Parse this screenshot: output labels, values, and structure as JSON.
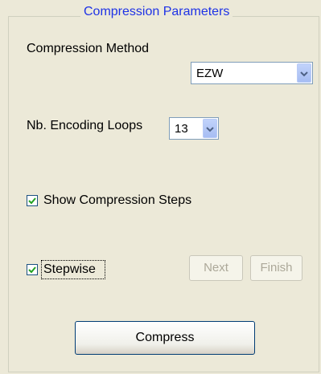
{
  "group": {
    "title": "Compression Parameters"
  },
  "compression_method": {
    "label": "Compression Method",
    "value": "EZW"
  },
  "encoding_loops": {
    "label": "Nb. Encoding Loops",
    "value": "13"
  },
  "show_steps": {
    "label": "Show Compression Steps",
    "checked": true
  },
  "stepwise": {
    "label": "Stepwise",
    "checked": true
  },
  "buttons": {
    "next": "Next",
    "finish": "Finish",
    "compress": "Compress"
  },
  "colors": {
    "background": "#ece9d8",
    "title": "#1e32e6",
    "checkmark": "#21a121"
  }
}
